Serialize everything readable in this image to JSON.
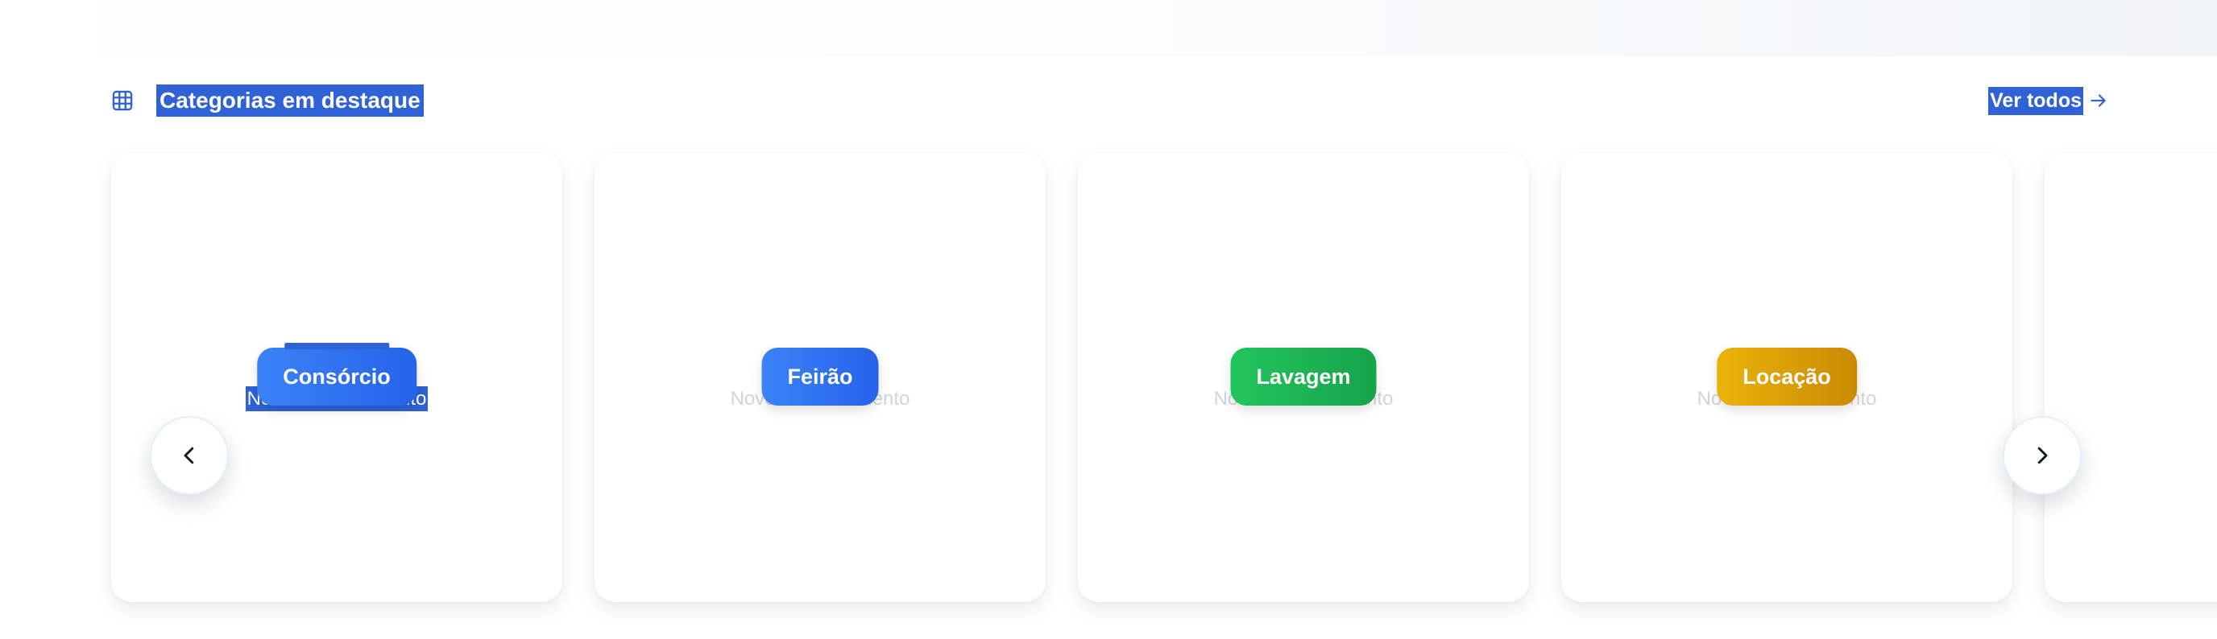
{
  "section": {
    "title": "Categorias em destaque",
    "see_all_label": "Ver todos",
    "icon": "grid-icon",
    "accent": "#2f62d4"
  },
  "carousel": {
    "prev_icon": "chevron-left-icon",
    "next_icon": "chevron-right-icon",
    "cards": [
      {
        "label": "Consórcio",
        "subtitle": "Novo em andamento",
        "color_from": "#3b82f6",
        "color_to": "#2563eb"
      },
      {
        "label": "Feirão",
        "subtitle": "Novo em andamento",
        "color_from": "#3b82f6",
        "color_to": "#2563eb"
      },
      {
        "label": "Lavagem",
        "subtitle": "Novo em andamento",
        "color_from": "#22c55e",
        "color_to": "#16a34a"
      },
      {
        "label": "Locação",
        "subtitle": "Novo em andamento",
        "color_from": "#eab308",
        "color_to": "#ca8a04"
      }
    ]
  }
}
